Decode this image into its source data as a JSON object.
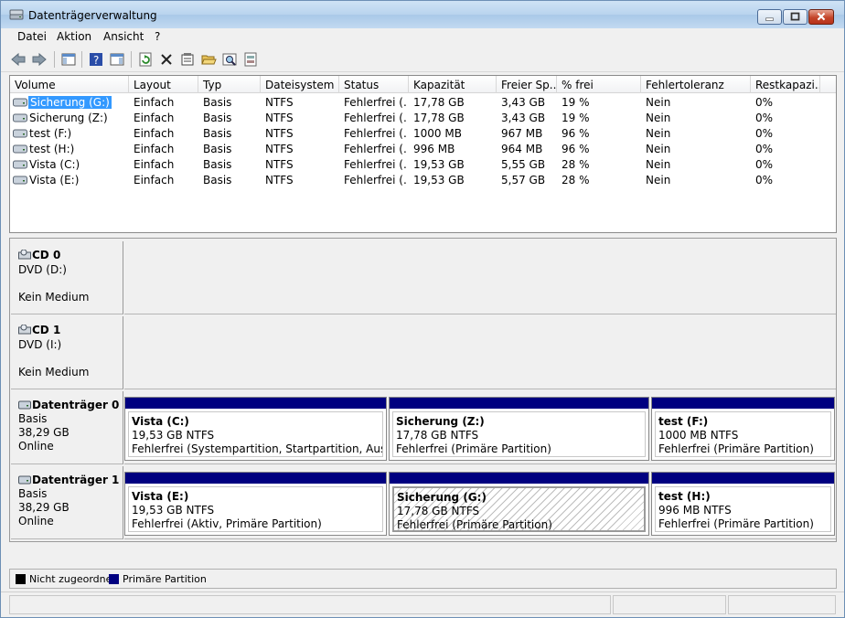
{
  "window": {
    "title": "Datenträgerverwaltung",
    "icon": "disk-management-icon"
  },
  "menu": [
    {
      "label": "Datei"
    },
    {
      "label": "Aktion"
    },
    {
      "label": "Ansicht"
    },
    {
      "label": "?"
    }
  ],
  "toolbar": {
    "buttons": [
      "back-arrow-icon",
      "forward-arrow-icon",
      "show-hide-console-tree-icon",
      "help-icon",
      "show-hide-action-pane-icon",
      "refresh-icon",
      "delete-icon",
      "properties-icon",
      "open-folder-icon",
      "explore-icon",
      "rescan-disks-icon"
    ]
  },
  "volumes": {
    "columns": [
      "Volume",
      "Layout",
      "Typ",
      "Dateisystem",
      "Status",
      "Kapazität",
      "Freier Sp...",
      "% frei",
      "Fehlertoleranz",
      "Restkapazi..."
    ],
    "rows": [
      {
        "name": "Sicherung (G:)",
        "layout": "Einfach",
        "type": "Basis",
        "fs": "NTFS",
        "status": "Fehlerfrei (...",
        "capacity": "17,78 GB",
        "free": "3,43 GB",
        "pct": "19 %",
        "fault": "Nein",
        "overhead": "0%",
        "selected": true
      },
      {
        "name": "Sicherung (Z:)",
        "layout": "Einfach",
        "type": "Basis",
        "fs": "NTFS",
        "status": "Fehlerfrei (...",
        "capacity": "17,78 GB",
        "free": "3,43 GB",
        "pct": "19 %",
        "fault": "Nein",
        "overhead": "0%"
      },
      {
        "name": "test (F:)",
        "layout": "Einfach",
        "type": "Basis",
        "fs": "NTFS",
        "status": "Fehlerfrei (...",
        "capacity": "1000 MB",
        "free": "967 MB",
        "pct": "96 %",
        "fault": "Nein",
        "overhead": "0%"
      },
      {
        "name": "test (H:)",
        "layout": "Einfach",
        "type": "Basis",
        "fs": "NTFS",
        "status": "Fehlerfrei (...",
        "capacity": "996 MB",
        "free": "964 MB",
        "pct": "96 %",
        "fault": "Nein",
        "overhead": "0%"
      },
      {
        "name": "Vista (C:)",
        "layout": "Einfach",
        "type": "Basis",
        "fs": "NTFS",
        "status": "Fehlerfrei (...",
        "capacity": "19,53 GB",
        "free": "5,55 GB",
        "pct": "28 %",
        "fault": "Nein",
        "overhead": "0%"
      },
      {
        "name": "Vista (E:)",
        "layout": "Einfach",
        "type": "Basis",
        "fs": "NTFS",
        "status": "Fehlerfrei (...",
        "capacity": "19,53 GB",
        "free": "5,57 GB",
        "pct": "28 %",
        "fault": "Nein",
        "overhead": "0%"
      }
    ]
  },
  "disks": [
    {
      "name": "CD 0",
      "line1": "DVD (D:)",
      "line2": "",
      "line3": "Kein Medium",
      "icon": "cd-drive-icon",
      "partitions": []
    },
    {
      "name": "CD 1",
      "line1": "DVD (I:)",
      "line2": "",
      "line3": "Kein Medium",
      "icon": "cd-drive-icon",
      "partitions": []
    },
    {
      "name": "Datenträger 0",
      "line1": "Basis",
      "line2": "38,29 GB",
      "line3": "Online",
      "icon": "hard-disk-icon",
      "partitions": [
        {
          "name": "Vista  (C:)",
          "size": "19,53 GB NTFS",
          "status": "Fehlerfrei (Systempartition, Startpartition, Auslageru"
        },
        {
          "name": "Sicherung  (Z:)",
          "size": "17,78 GB NTFS",
          "status": "Fehlerfrei (Primäre Partition)"
        },
        {
          "name": "test  (F:)",
          "size": "1000 MB NTFS",
          "status": "Fehlerfrei (Primäre Partition)"
        }
      ]
    },
    {
      "name": "Datenträger 1",
      "line1": "Basis",
      "line2": "38,29 GB",
      "line3": "Online",
      "icon": "hard-disk-icon",
      "partitions": [
        {
          "name": "Vista  (E:)",
          "size": "19,53 GB NTFS",
          "status": "Fehlerfrei (Aktiv, Primäre Partition)"
        },
        {
          "name": "Sicherung  (G:)",
          "size": "17,78 GB NTFS",
          "status": "Fehlerfrei (Primäre Partition)",
          "selected": true
        },
        {
          "name": "test  (H:)",
          "size": "996 MB NTFS",
          "status": "Fehlerfrei (Primäre Partition)"
        }
      ]
    }
  ],
  "legend": [
    {
      "label": "Nicht zugeordnet",
      "color": "#000000"
    },
    {
      "label": "Primäre Partition",
      "color": "#000080"
    }
  ]
}
